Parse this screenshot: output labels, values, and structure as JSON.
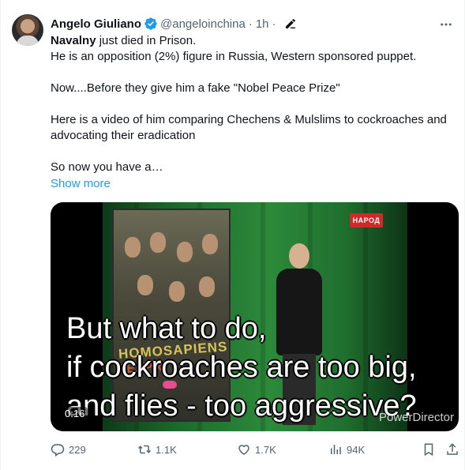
{
  "author": {
    "name": "Angelo Giuliano",
    "handle": "@angeloinchina",
    "time": "1h"
  },
  "body": {
    "line1_bold": "Navalny",
    "line1_rest": " just died in Prison.",
    "line2": "He is an opposition (2%) figure in Russia, Western sponsored puppet.",
    "line3": "Now....Before they give him a fake \"Nobel Peace Prize\"",
    "line4": "Here is a video of him comparing Chechens & Mulslims to cockroaches and advocating their eradication",
    "line5": "So now you have a…",
    "show_more": "Show more"
  },
  "video": {
    "caption_line1": "But what to do,",
    "caption_line2": "if cockroaches are too big,",
    "caption_line3": "and flies - too aggressive?",
    "timestamp": "0:16",
    "watermark": "PowerDirector",
    "channel_logo": "НАРОД",
    "poster_text1": "HOMOSAPIENS",
    "poster_text2": "BEZPR"
  },
  "actions": {
    "reply_count": "229",
    "repost_count": "1.1K",
    "like_count": "1.7K",
    "views_count": "94K"
  },
  "icons": {
    "verified": "verified-badge-icon",
    "edit": "edit-pencil-icon",
    "more": "more-dots-icon",
    "reply": "reply-icon",
    "repost": "repost-icon",
    "like": "heart-icon",
    "views": "views-chart-icon",
    "bookmark": "bookmark-icon",
    "share": "share-icon"
  },
  "colors": {
    "link": "#1d9bf0",
    "muted": "#536471",
    "text": "#0f1419"
  }
}
